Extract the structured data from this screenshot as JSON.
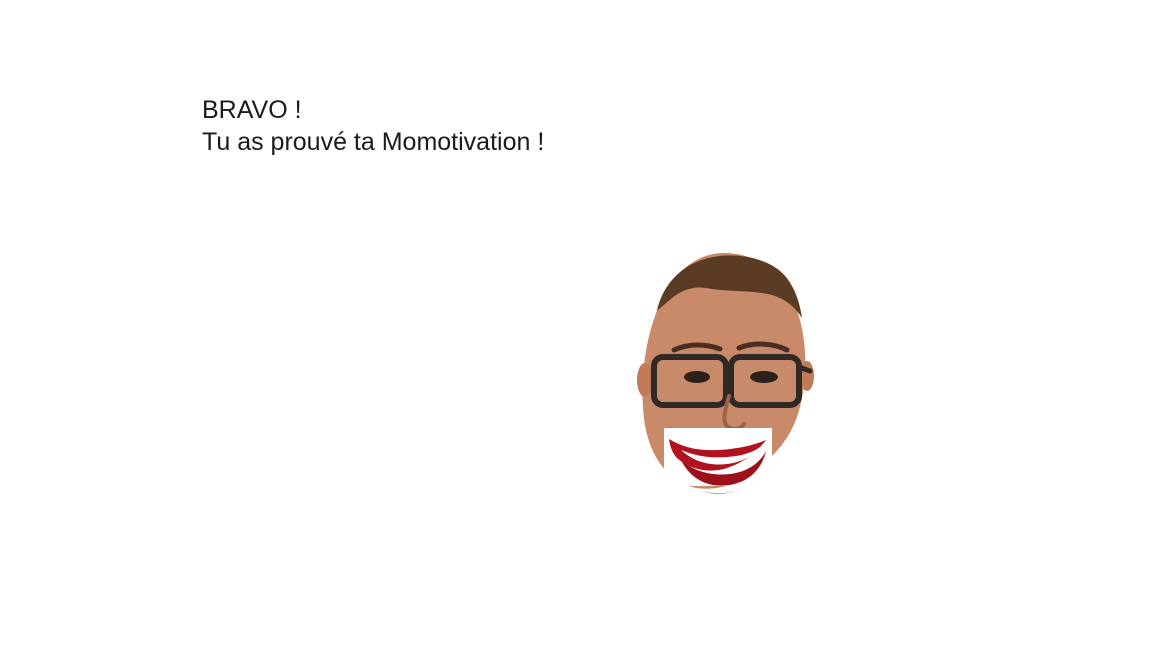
{
  "message": {
    "line1": "BRAVO !",
    "line2": "Tu as prouvé ta Momotivation !"
  },
  "portrait": {
    "subject": "man-face-with-glasses-and-cartoon-smile",
    "mouth_sticker": "red-lips-teeth-smile"
  },
  "colors": {
    "background": "#ffffff",
    "text": "#1a1a1a",
    "skin": "#c98a6a",
    "hair": "#5a3b24",
    "glasses": "#2f2a26",
    "lips": "#b1121d",
    "teeth": "#ffffff"
  }
}
